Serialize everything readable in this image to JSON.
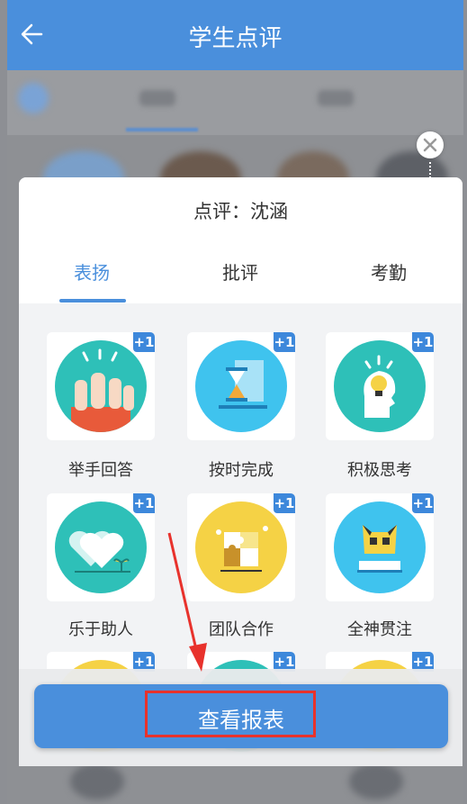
{
  "header": {
    "title": "学生点评",
    "back_icon": "arrow-left-icon"
  },
  "panel": {
    "title": "点评：沈涵",
    "tabs": [
      {
        "label": "表扬",
        "active": true
      },
      {
        "label": "批评",
        "active": false
      },
      {
        "label": "考勤",
        "active": false
      }
    ],
    "items": [
      {
        "label": "举手回答",
        "badge": "+1",
        "icon": "raised-hands-icon",
        "color": "#2ec0b8"
      },
      {
        "label": "按时完成",
        "badge": "+1",
        "icon": "hourglass-icon",
        "color": "#3fc3ee"
      },
      {
        "label": "积极思考",
        "badge": "+1",
        "icon": "lightbulb-head-icon",
        "color": "#2ec0b8"
      },
      {
        "label": "乐于助人",
        "badge": "+1",
        "icon": "hearts-icon",
        "color": "#2ec0b8"
      },
      {
        "label": "团队合作",
        "badge": "+1",
        "icon": "puzzle-icon",
        "color": "#f5d245"
      },
      {
        "label": "全神贯注",
        "badge": "+1",
        "icon": "owl-icon",
        "color": "#3fc3ee"
      },
      {
        "label": "",
        "badge": "+1",
        "icon": "partial-icon",
        "color": "#f5d245"
      },
      {
        "label": "",
        "badge": "+1",
        "icon": "partial-icon",
        "color": "#2ec0b8"
      },
      {
        "label": "",
        "badge": "+1",
        "icon": "partial-icon",
        "color": "#f5d245"
      }
    ]
  },
  "report_button": {
    "label": "查看报表"
  },
  "colors": {
    "primary": "#4a8fdc",
    "highlight": "#e8322c"
  }
}
